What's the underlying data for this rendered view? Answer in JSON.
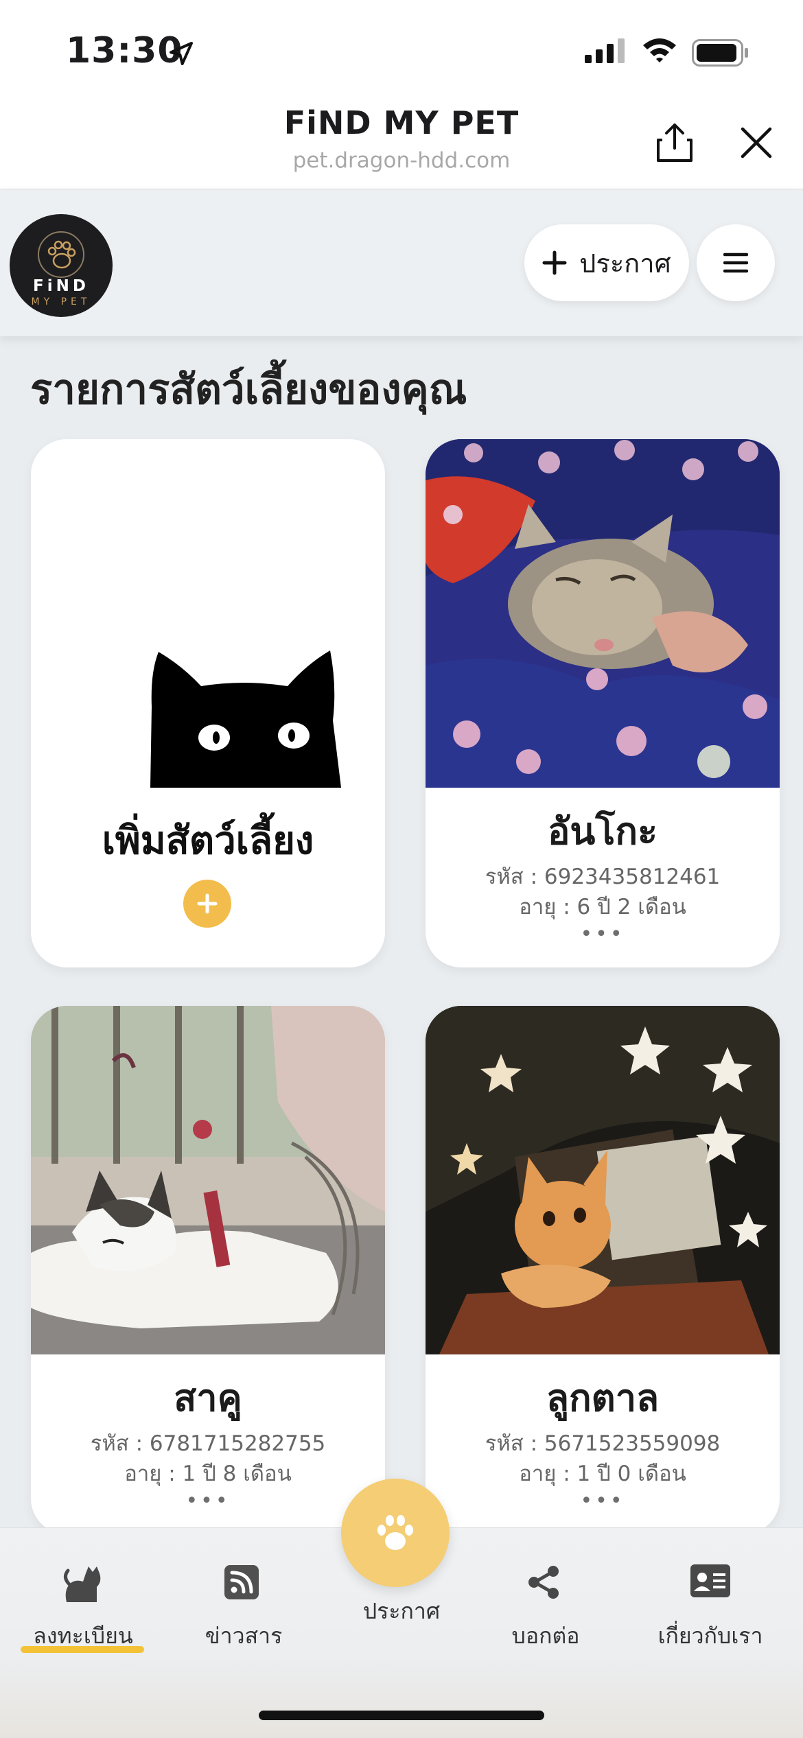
{
  "status_bar": {
    "time": "13:30"
  },
  "browser": {
    "title": "FiND MY PET",
    "url": "pet.dragon-hdd.com"
  },
  "header": {
    "logo_line1": "FiND",
    "logo_line2": "MY PET",
    "post_button": "ประกาศ"
  },
  "page_title": "รายการสัตว์เลี้ยงของคุณ",
  "add_card": {
    "label": "เพิ่มสัตว์เลี้ยง"
  },
  "pets": [
    {
      "name": "อันโกะ",
      "code": "รหัส : 6923435812461",
      "age": "อายุ : 6 ปี 2 เดือน",
      "more": "•••"
    },
    {
      "name": "สาคู",
      "code": "รหัส : 6781715282755",
      "age": "อายุ : 1 ปี 8 เดือน",
      "more": "•••"
    },
    {
      "name": "ลูกตาล",
      "code": "รหัส : 5671523559098",
      "age": "อายุ : 1 ปี 0 เดือน",
      "more": "•••"
    }
  ],
  "bottom_nav": {
    "items": [
      {
        "label": "ลงทะเบียน",
        "icon": "cat-icon",
        "active": true
      },
      {
        "label": "ข่าวสาร",
        "icon": "rss-icon"
      },
      {
        "label": "ประกาศ",
        "icon": "paw-icon"
      },
      {
        "label": "บอกต่อ",
        "icon": "share-nodes-icon"
      },
      {
        "label": "เกี่ยวกับเรา",
        "icon": "id-card-icon"
      }
    ]
  },
  "colors": {
    "accent": "#f4c237",
    "plus_button": "#f2bd4c",
    "center_button": "#f4cd74"
  }
}
